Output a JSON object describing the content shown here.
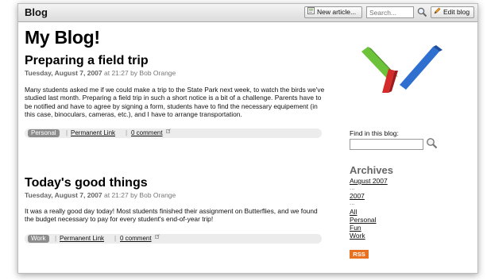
{
  "toolbar": {
    "title": "Blog",
    "new_article_label": "New article...",
    "search_placeholder": "Search...",
    "edit_blog_label": "Edit blog"
  },
  "blog": {
    "title": "My Blog!"
  },
  "posts": [
    {
      "title": "Preparing a field trip",
      "date": "Tuesday, August 7, 2007",
      "meta_rest": " at 21:27 by Bob Orange",
      "body": "Many students asked me if we could make a trip to the State Park next week, to watch the birds we've studied last month. Preparing a field trip in such a short notice is a bit of a challenge. Parents have to be notified and have to agree by signing a form, students have to find the necessary equipement (in this case, binoculars, cameras, etc.), and I have to arrange transportation.",
      "tag": "Personal",
      "permalink": "Permanent Link",
      "comments": "0 comment"
    },
    {
      "title": "Today's good things",
      "date": "Tuesday, August 7, 2007",
      "meta_rest": " at 21:27 by Bob Orange",
      "body": "It was a really good day today! Most students finished their assignment on Butterflies, and we found the budget necessary to pay for every student's end-of-year trip!",
      "tag": "Work",
      "permalink": "Permanent Link",
      "comments": "0 comment"
    }
  ],
  "sidebar": {
    "find_label": "Find in this blog:",
    "archives_heading": "Archives",
    "archive_month": "August 2007",
    "archive_year": "2007",
    "ellipsis": "...",
    "categories": [
      "All",
      "Personal",
      "Fun",
      "Work"
    ],
    "rss_label": "RSS"
  },
  "colors": {
    "rss": "#e8701f",
    "logo_green": "#6cc33a",
    "logo_red": "#d42a2a",
    "logo_blue": "#2f6fd0"
  }
}
